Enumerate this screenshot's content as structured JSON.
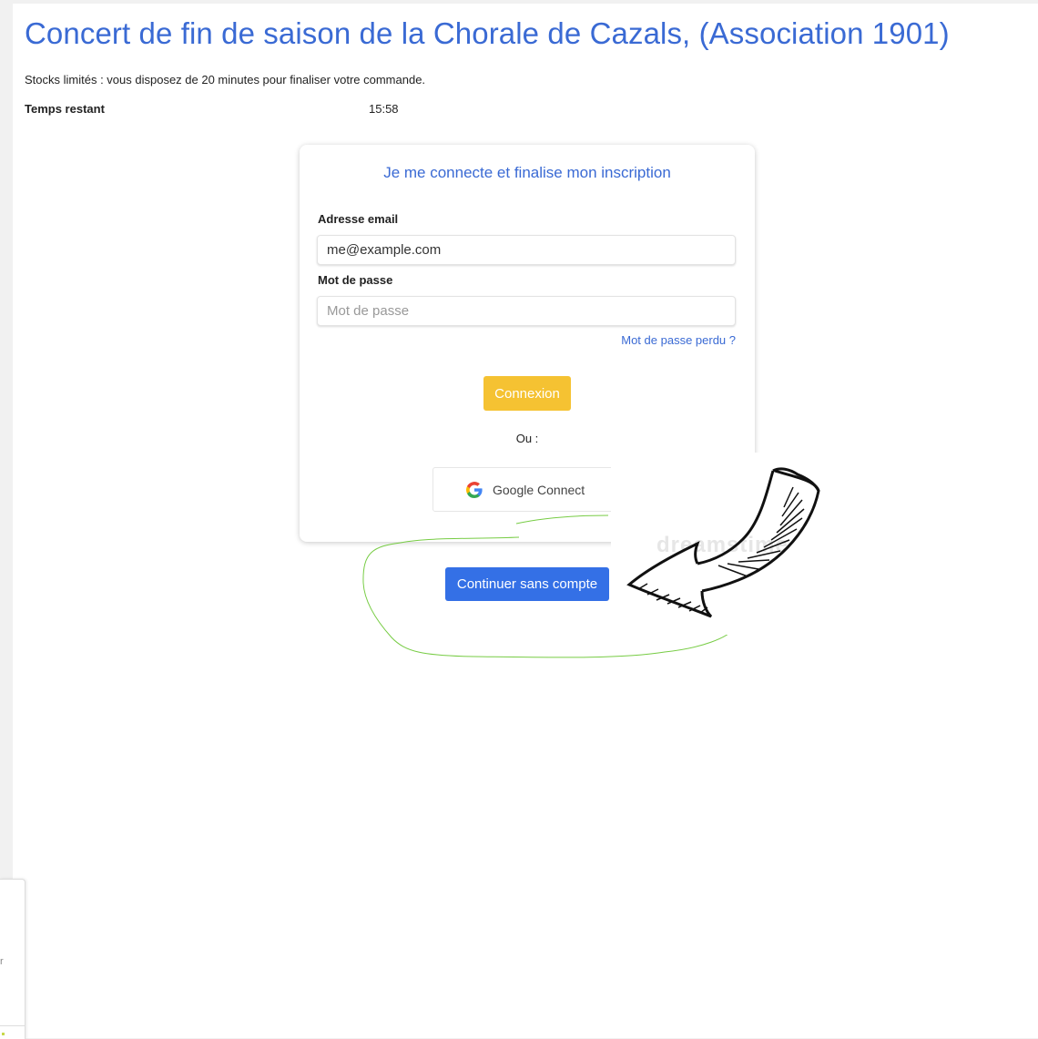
{
  "header": {
    "title": "Concert de fin de saison de la Chorale de Cazals, (Association 1901)",
    "stock_notice": "Stocks limités : vous disposez de 20 minutes pour finaliser votre commande.",
    "timer_label": "Temps restant",
    "timer_value": "15:58"
  },
  "login_card": {
    "title": "Je me connecte et finalise mon inscription",
    "email_label": "Adresse email",
    "email_value": "me@example.com",
    "password_label": "Mot de passe",
    "password_placeholder": "Mot de passe",
    "forgot_link": "Mot de passe perdu ?",
    "login_button": "Connexion",
    "or_label": "Ou :",
    "google_button": "Google Connect",
    "google_icon": "google-g-icon"
  },
  "continue_button": "Continuer sans compte",
  "annotations": {
    "arrow_icon": "hand-drawn-arrow-icon",
    "scribble_color": "#77cc44",
    "watermark": "dreamstime"
  },
  "colors": {
    "title_blue": "#3a6ad4",
    "login_yellow": "#f5c232",
    "continue_blue": "#3470e6",
    "background_gray": "#f1f1f1"
  },
  "side_panel": {
    "glyph": "r"
  }
}
